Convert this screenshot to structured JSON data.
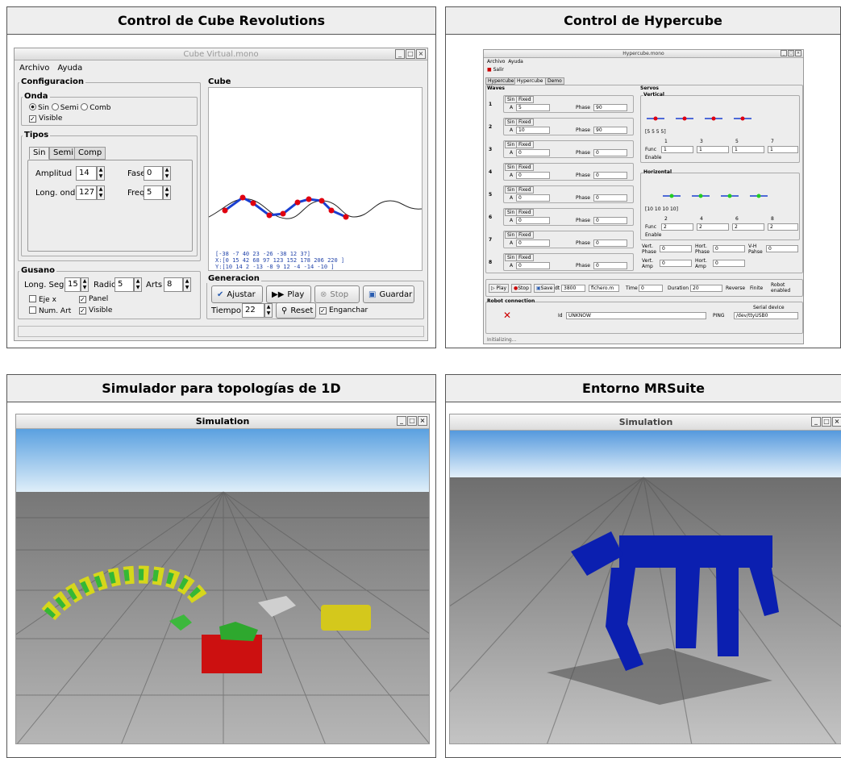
{
  "panels": {
    "p1_title": "Control de Cube Revolutions",
    "p2_title": "Control de Hypercube",
    "p3_title": "Simulador para topologías de 1D",
    "p4_title": "Entorno MRSuite"
  },
  "cube_window": {
    "title": "Cube Virtual.mono",
    "menu": [
      "Archivo",
      "Ayuda"
    ],
    "configuracion": "Configuracion",
    "onda": "Onda",
    "onda_options": [
      "Sin",
      "Semi",
      "Comb"
    ],
    "visible": "Visible",
    "tipos": "Tipos",
    "tabs": [
      "Sin",
      "Semi",
      "Comp"
    ],
    "amplitud_label": "Amplitud",
    "amplitud_value": "14",
    "fase_label": "Fase",
    "fase_value": "0",
    "long_onda_label": "Long. onda",
    "long_onda_value": "127",
    "freq_label": "Freq",
    "freq_value": "5",
    "gusano": "Gusano",
    "long_seg_label": "Long. Seg",
    "long_seg_value": "15",
    "radio_label": "Radio",
    "radio_value": "5",
    "arts_label": "Arts",
    "arts_value": "8",
    "eje_x": "Eje x",
    "panel": "Panel",
    "num_art": "Num. Art",
    "visible2": "Visible",
    "cube_label": "Cube",
    "readout_1": "[-38 -7 40 23 -26 -38 12 37]",
    "readout_2": "X:[0 15 42 68 97 123 152 178 206 220 ]",
    "readout_3": "Y:[10 14 2 -13 -8 9 12 -4 -14 -10 ]",
    "generacion": "Generacion",
    "ajustar": "Ajustar",
    "play": "Play",
    "stop": "Stop",
    "guardar": "Guardar",
    "tiempo_label": "Tiempo",
    "tiempo_value": "22",
    "reset": "Reset",
    "enganchar": "Enganchar"
  },
  "hyper_window": {
    "title": "Hypercube.mono",
    "menu": [
      "Archivo",
      "Ayuda"
    ],
    "salir": "Salir",
    "tabs": [
      "Hypercube I",
      "Hypercube II",
      "Demo"
    ],
    "waves_label": "Waves",
    "waves": [
      {
        "n": "1",
        "a": "5",
        "phase": "90"
      },
      {
        "n": "2",
        "a": "10",
        "phase": "90"
      },
      {
        "n": "3",
        "a": "0",
        "phase": "0"
      },
      {
        "n": "4",
        "a": "0",
        "phase": "0"
      },
      {
        "n": "5",
        "a": "0",
        "phase": "0"
      },
      {
        "n": "6",
        "a": "0",
        "phase": "0"
      },
      {
        "n": "7",
        "a": "0",
        "phase": "0"
      },
      {
        "n": "8",
        "a": "0",
        "phase": "0"
      }
    ],
    "sin": "Sin",
    "fixed": "Fixed",
    "a_label": "A",
    "phase_label": "Phase",
    "servos": "Servos",
    "vertical": "Vertical",
    "horizontal": "Horizontal",
    "v_vals": "[5 5 5 5]",
    "h_vals": "[10 10 10 10]",
    "v_nums": [
      "1",
      "3",
      "5",
      "7"
    ],
    "h_nums": [
      "2",
      "4",
      "6",
      "8"
    ],
    "func": "Func",
    "enable": "Enable",
    "v_func": [
      "1",
      "1",
      "1",
      "1"
    ],
    "h_func": [
      "2",
      "2",
      "2",
      "2"
    ],
    "vert_phase": "Vert. Phase",
    "hort_phase": "Hort. Phase",
    "vh_pahse": "V-H Pahse",
    "vert_amp": "Vert. Amp",
    "hort_amp": "Hort. Amp",
    "vp_val": "0",
    "hp_val": "0",
    "vh_val": "0",
    "va_val": "0",
    "ha_val": "0",
    "play": "Play",
    "stop": "Stop",
    "save": "Save",
    "dt_label": "dt",
    "dt_value": "3800",
    "file": "fichero.m",
    "time_label": "Time",
    "time_value": "0",
    "duration_label": "Duration",
    "duration_value": "20",
    "reverse": "Reverse",
    "finite": "Finite",
    "robot_enabled": "Robot enabled",
    "robot_connection": "Robot connection",
    "id_label": "Id",
    "id_value": "UNKNOW",
    "ping": "PING",
    "serial_device": "Serial device",
    "serial_value": "/dev/ttyUSB0",
    "status": "Initializing..."
  },
  "sim1": {
    "title": "Simulation"
  },
  "sim2": {
    "title": "Simulation"
  }
}
